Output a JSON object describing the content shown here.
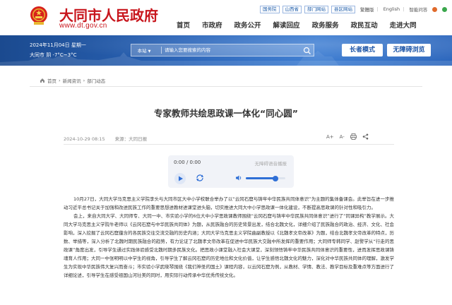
{
  "header": {
    "site_title": "大同市人民政府",
    "site_url": "www.dt.gov.cn",
    "top_links": [
      "国务院",
      "山西省",
      "部门网站",
      "县区网站"
    ],
    "top_text_links": [
      "繁體版",
      "English",
      "智能问答"
    ],
    "nav": [
      "首页",
      "市政府",
      "政务公开",
      "解读回应",
      "政务服务",
      "政民互动",
      "走进大同"
    ]
  },
  "banner": {
    "date": "2024年11月04日 星期一",
    "weather": "大同市 阴 -7°C~3°C",
    "search_scope": "本站",
    "search_placeholder": "请输入您要搜索的内容",
    "elder_mode": "长者模式",
    "accessible": "无障碍浏览"
  },
  "breadcrumb": [
    "首页",
    "新闻资讯",
    "部门动态"
  ],
  "article": {
    "title": "专家教师共绘思政课一体化“同心圆”",
    "date": "2024-10-29 08:15",
    "source": "来源：大同日报",
    "tools": [
      "A+",
      "A-",
      "打印"
    ],
    "paragraphs": [
      "10月27日，大同大学马克思主义学院李头与大同市区大中小学校联合举办了以“云冈石窟与铸牢中华民族共同体意识”为主题的集体备课会。此举旨在进一步推动习近平总书记关于加强和改进民族工作的重要思想进教材进课堂进头脑，切实推进大同大中小学思政课一体化建设，不断提高思政课的针对性和吸引力。",
      "会上，来自大同大学、大同师专、大同一中、市实验小学的6位大中小学思政课教师围绕“云冈石窟与铸牢中华民族共同体意识”进行了“同课异构”教学展示。大同大学马克思主义学院牛老师以《云冈石窟与中华民族共同体》为题，从民族融合的历史背景出发，结合北魏文化，详细介绍了民族融合的政治、经济、文化、社会影响，深入挖掘了云冈石窟蕴含的各民族交往交流交融的历史内涵；大同大学马克思主义学院曲副教授以《北魏孝文帝改革》为题，结合北魏孝文帝改革的特点，历数、举措等，深入分析了北魏时期民族融合的趋势，有力论证了北魏孝文帝改革在促进中华民族大交融中所发挥的重要作用；大同师专韩同学、赵警学从“行走的思政课”角度出发，引导学生通过实践体验感受北魏时期多民族文化。把思政小课堂融入社会大课堂，深刻领悟铸牢中华民族共同体意识的重要性，进而发挥思政课铸魂育人作用；大同一中张明明以中学生的视角，引导学生了解云冈石窟的历史地位和文化价值，让学生感悟北魏文化的魅力，深化对中华民族共同体的理解，激发学生为实现中华民族伟大复兴而奋斗；市实验小学武晓琴围绕《我们神圣的国土》课程内容，以云冈石窟为例，从教材、学情、教法、教学目标及重难点等方面进行了详细论述，引导学生在感受祖国山河壮美的同时，用实际行动传承中华优秀传统文化。"
    ]
  },
  "player": {
    "time": "0:00 / 0:00",
    "label": "无障碍语音播报",
    "volume_level": 0.75
  },
  "colors": {
    "brand_red": "#c8161d",
    "banner_blue": "#2a64b8",
    "player_accent": "#2f6fd6"
  }
}
